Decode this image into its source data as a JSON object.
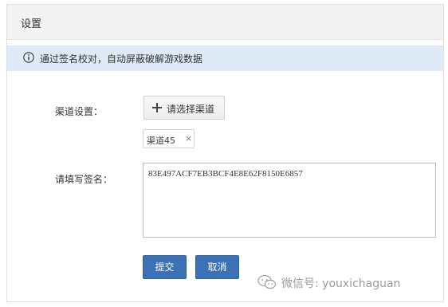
{
  "panel": {
    "title": "设置"
  },
  "info": {
    "text": "通过签名校对，自动屏蔽破解游戏数据",
    "icon": "info-icon"
  },
  "form": {
    "channel_label": "渠道设置：",
    "select_button_label": "请选择渠道",
    "selected_tags": [
      {
        "label": "渠道45",
        "remove": "×"
      }
    ],
    "sign_label": "请填写签名：",
    "sign_value": "83E497ACF7EB3BCF4E8E62F8150E6857"
  },
  "actions": {
    "submit_label": "提交",
    "cancel_label": "取消"
  },
  "watermark": {
    "text": "微信号: youxichaguan"
  },
  "colors": {
    "accent": "#3a72b5",
    "info_bg": "#dfeaf7",
    "header_bg": "#f3f3f3"
  }
}
